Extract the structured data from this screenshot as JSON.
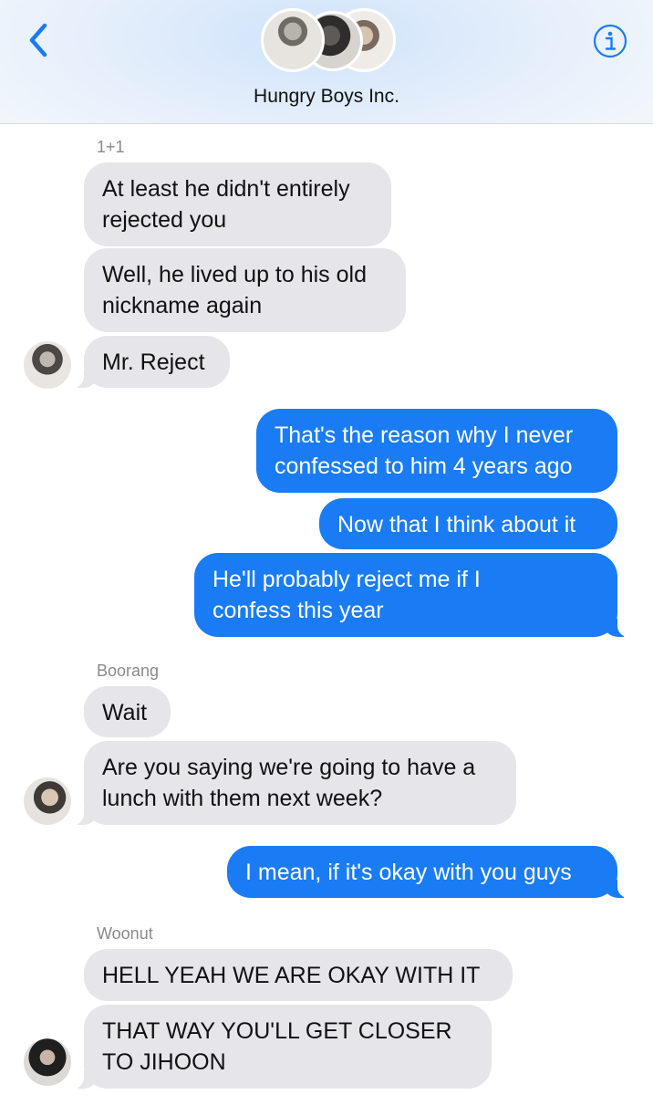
{
  "header": {
    "title": "Hungry Boys Inc.",
    "back_icon": "chevron-left-icon",
    "info_icon": "info-icon",
    "accent": "#1a7cf5"
  },
  "messages": [
    {
      "sender": "1+1"
    },
    {
      "text": "At least he didn't entirely\nrejected you"
    },
    {
      "text": "Well, he lived up to his old\nnickname again"
    },
    {
      "text": "Mr. Reject"
    },
    {
      "text": "That's the reason why I never\nconfessed to him 4 years ago"
    },
    {
      "text": "Now that I think about it"
    },
    {
      "text": "He'll probably reject me if I\nconfess this year"
    },
    {
      "sender": "Boorang"
    },
    {
      "text": "Wait"
    },
    {
      "text": "Are you saying we're going to have a\nlunch with them next week?"
    },
    {
      "text": "I mean, if it's okay with you guys"
    },
    {
      "sender": "Woonut"
    },
    {
      "text": "HELL YEAH WE ARE OKAY WITH IT"
    },
    {
      "text": "THAT WAY YOU'LL GET CLOSER\nTO JIHOON"
    }
  ],
  "colors": {
    "incoming_bubble": "#e5e5ea",
    "outgoing_bubble": "#1a7cf5",
    "sender_label": "#8a8a8e"
  }
}
